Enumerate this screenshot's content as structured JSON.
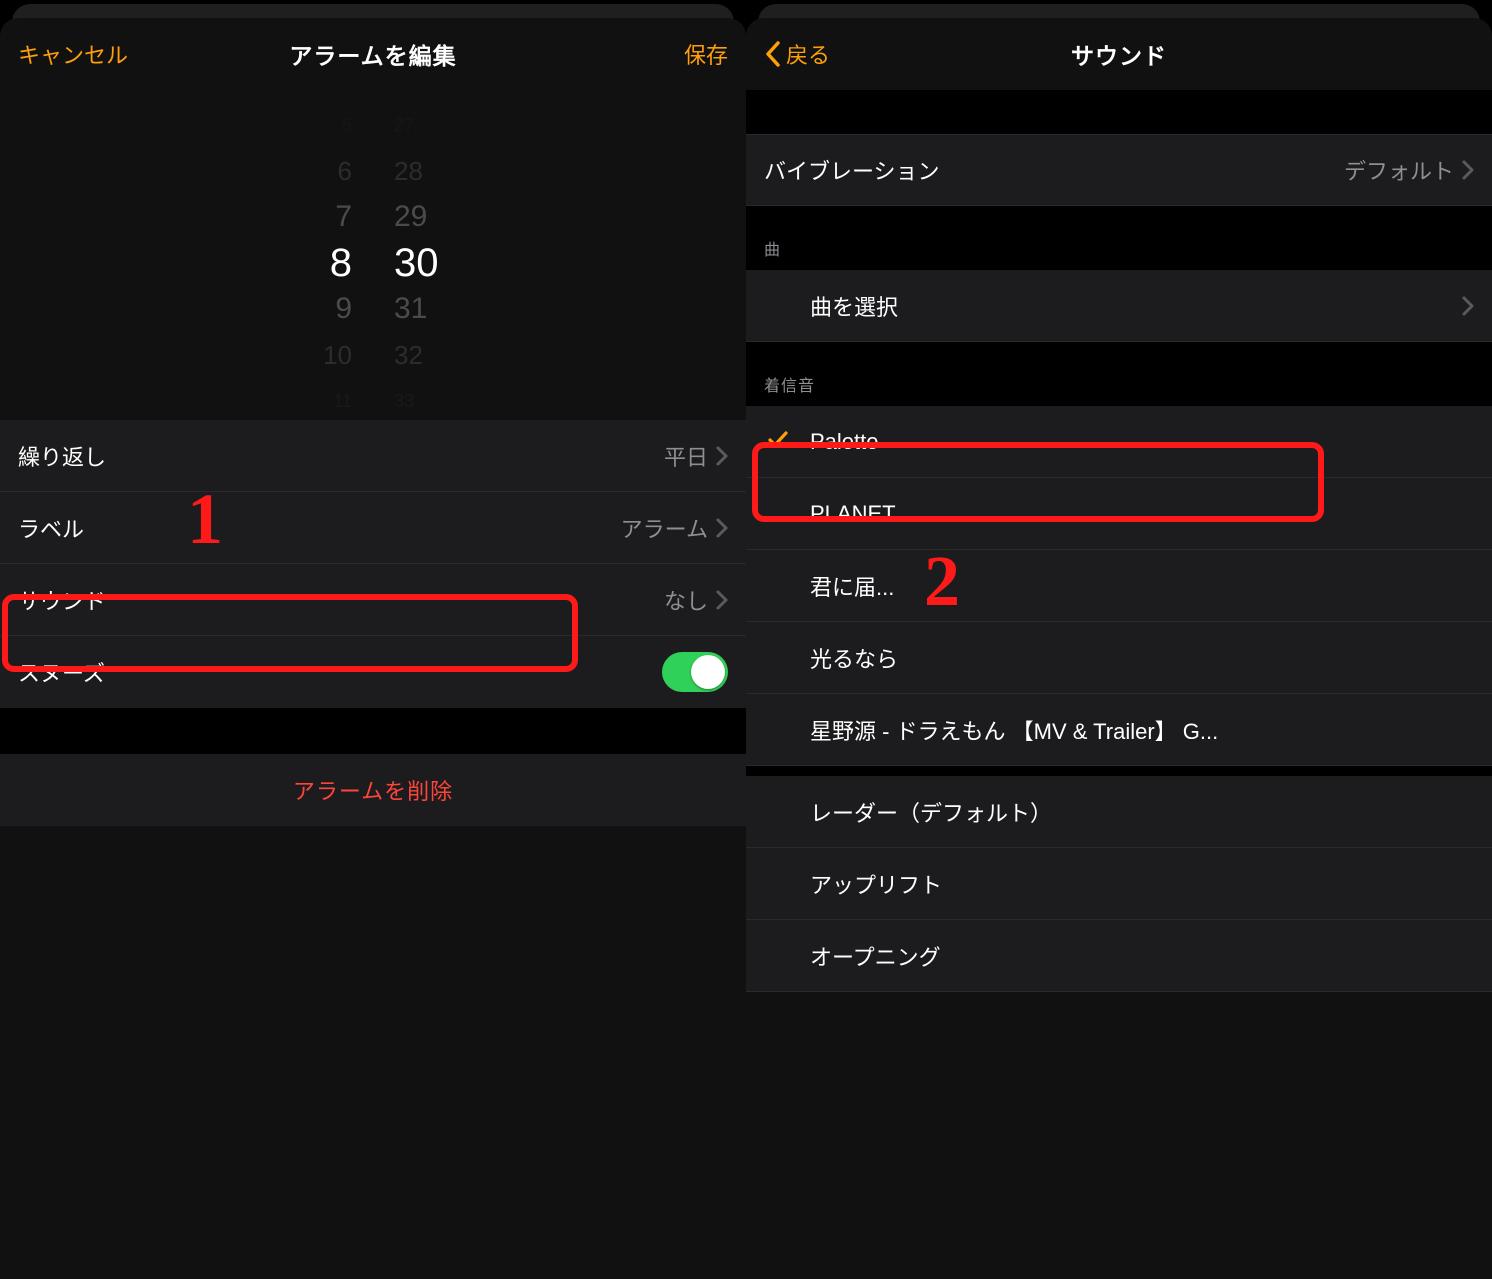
{
  "left": {
    "nav": {
      "cancel": "キャンセル",
      "title": "アラームを編集",
      "save": "保存"
    },
    "wheel": {
      "hours": [
        "5",
        "6",
        "7",
        "8",
        "9",
        "10",
        "11"
      ],
      "minutes": [
        "27",
        "28",
        "29",
        "30",
        "31",
        "32",
        "33"
      ],
      "selectedIndex": 3
    },
    "rows": {
      "repeat": {
        "label": "繰り返し",
        "value": "平日"
      },
      "labelRow": {
        "label": "ラベル",
        "value": "アラーム"
      },
      "sound": {
        "label": "サウンド",
        "value": "なし"
      },
      "snooze": {
        "label": "スヌーズ",
        "on": true
      }
    },
    "delete": "アラームを削除",
    "annot": "1"
  },
  "right": {
    "nav": {
      "back": "戻る",
      "title": "サウンド"
    },
    "vibration": {
      "label": "バイブレーション",
      "value": "デフォルト"
    },
    "songHeader": "曲",
    "pickSong": "曲を選択",
    "ringHeader": "着信音",
    "ringtones": [
      {
        "name": "Palette",
        "selected": true
      },
      {
        "name": "PLANET"
      },
      {
        "name": "君に届..."
      },
      {
        "name": "光るなら"
      },
      {
        "name": "星野源 - ドラえもん 【MV & Trailer】  G..."
      },
      {
        "name": "レーダー（デフォルト）"
      },
      {
        "name": "アップリフト"
      },
      {
        "name": "オープニング"
      }
    ],
    "annot": "2"
  }
}
